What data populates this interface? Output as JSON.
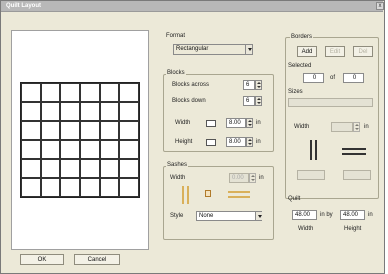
{
  "window": {
    "title": "Quilt Layout",
    "close_glyph": "x"
  },
  "format": {
    "label": "Format",
    "value": "Rectangular"
  },
  "blocks": {
    "label": "Blocks",
    "across_label": "Blocks across",
    "across_value": "6",
    "down_label": "Blocks down",
    "down_value": "6",
    "width_label": "Width",
    "width_value": "8.00",
    "height_label": "Height",
    "height_value": "8.00",
    "unit": "in"
  },
  "sashes": {
    "label": "Sashes",
    "width_label": "Width",
    "width_value": "0.00",
    "unit": "in",
    "style_label": "Style",
    "style_value": "None"
  },
  "borders": {
    "label": "Borders",
    "add": "Add",
    "edit": "Edit",
    "del": "Del",
    "selected_label": "Selected",
    "selected_a": "0",
    "of_label": "of",
    "selected_b": "0",
    "sizes_label": "Sizes",
    "width_label": "Width",
    "unit": "in"
  },
  "quilt": {
    "label": "Quilt",
    "width_value": "48.00",
    "by_label": "in by",
    "height_value": "48.00",
    "unit": "in",
    "width_caption": "Width",
    "height_caption": "Height"
  },
  "buttons": {
    "ok": "OK",
    "cancel": "Cancel"
  },
  "layout_grid": {
    "rows": 6,
    "cols": 6
  }
}
